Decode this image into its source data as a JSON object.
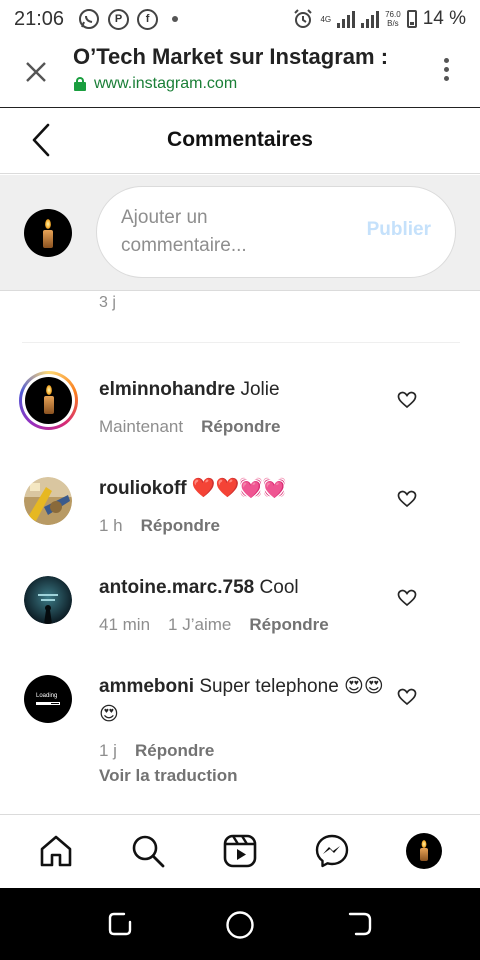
{
  "status_bar": {
    "time": "21:06",
    "network": "4G",
    "speed_value": "76.0",
    "speed_unit": "B/s",
    "battery": "14 %"
  },
  "browser": {
    "title": "O’Tech Market sur Instagram :",
    "url": "www.instagram.com"
  },
  "comments_page": {
    "title": "Commentaires"
  },
  "composer": {
    "placeholder": "Ajouter un commentaire...",
    "publish_label": "Publier"
  },
  "previous_comment_time": "3 j",
  "comments": [
    {
      "username": "elminnohandre",
      "text": "Jolie",
      "time": "Maintenant",
      "likes": "",
      "reply_label": "Répondre"
    },
    {
      "username": "rouliokoff",
      "text": "❤️❤️💓💓",
      "time": "1 h",
      "likes": "",
      "reply_label": "Répondre"
    },
    {
      "username": "antoine.marc.758",
      "text": "Cool",
      "time": "41 min",
      "likes": "1 J’aime",
      "reply_label": "Répondre"
    },
    {
      "username": "ammeboni",
      "text": "Super telephone 😍😍😍",
      "time": "1 j",
      "likes": "",
      "reply_label": "Répondre",
      "translate_label": "Voir la traduction",
      "avatar_text": "Loading"
    }
  ],
  "colors": {
    "link_green": "#1a7f37",
    "publish_disabled": "#c5e1fb",
    "secondary_text": "#8e8e8e"
  },
  "icons": {
    "nav": [
      "home-icon",
      "search-icon",
      "reels-icon",
      "messenger-icon",
      "profile-avatar"
    ],
    "android": [
      "recents-icon",
      "home-circle-icon",
      "back-icon"
    ]
  }
}
